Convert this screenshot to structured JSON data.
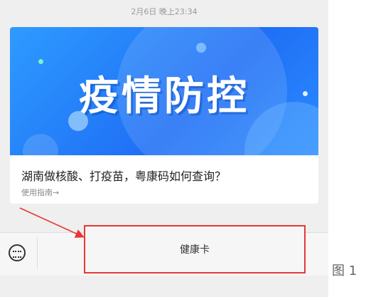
{
  "chat": {
    "timestamp": "2月6日 晚上23:34"
  },
  "article_card": {
    "banner_text": "疫情防控",
    "headline": "湖南做核酸、打疫苗，粤康码如何查询？",
    "subline": "使用指南→"
  },
  "bottom_menu": {
    "keyboard_icon": "keyboard-icon",
    "menu_label": "健康卡"
  },
  "annotation": {
    "caption": "图 1",
    "highlight_color": "#e53935"
  }
}
